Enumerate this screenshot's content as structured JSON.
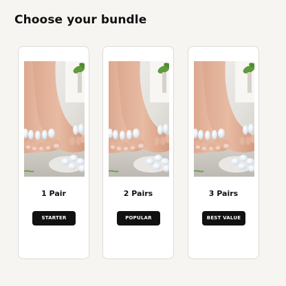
{
  "page": {
    "title": "Choose your bundle"
  },
  "bundles": [
    {
      "name": "1 Pair",
      "button_label": "STARTER"
    },
    {
      "name": "2 Pairs",
      "button_label": "POPULAR"
    },
    {
      "name": "3 Pairs",
      "button_label": "BEST VALUE"
    }
  ],
  "colors": {
    "background": "#f6f5f2",
    "card": "#ffffff",
    "button": "#111111",
    "button_text": "#ffffff",
    "separator_gel": "#e3eaf3"
  },
  "icons": {
    "product_photo": "feet-with-gel-toe-separators-image"
  }
}
